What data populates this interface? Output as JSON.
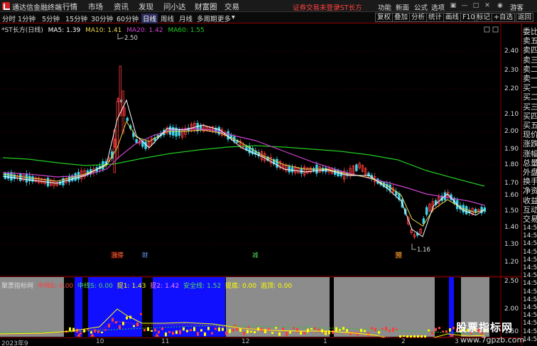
{
  "titlebar": {
    "app_title": "通达信金融终端",
    "menus": [
      "行情",
      "市场",
      "资讯",
      "发现",
      "问小达",
      "财富圈",
      "交易"
    ],
    "warning": "证券交易未登录",
    "stock_tab": "*ST长方",
    "right_menus": [
      "功能",
      "新面",
      "公式",
      "选项"
    ],
    "guest": "游客"
  },
  "toolbar": {
    "periods": [
      "分时",
      "1分钟",
      "5分钟",
      "15分钟",
      "30分钟",
      "60分钟",
      "日线",
      "周线",
      "月线",
      "多周期",
      "更多"
    ],
    "active_period": "日线",
    "right_buttons": [
      "复权",
      "叠加",
      "分析",
      "统计",
      "画线",
      "F10",
      "标记",
      "+自选",
      "返回"
    ]
  },
  "main_legend": {
    "stock": "*ST长方(日线)",
    "ma5": "MA5: 1.39",
    "ma10": "MA10: 1.41",
    "ma20": "MA20: 1.42",
    "ma60": "MA60: 1.55"
  },
  "annotations": {
    "high": "2.50",
    "low": "1.16",
    "tag1": "涨停",
    "tag2": "财",
    "tag3": "减",
    "tag4": "预"
  },
  "price_axis": [
    "2.40",
    "2.30",
    "2.20",
    "2.10",
    "2.00",
    "1.90",
    "1.80",
    "1.70",
    "1.60",
    "1.50",
    "1.40",
    "1.30",
    "1.20"
  ],
  "indicator": {
    "name": "聚票指标网",
    "fields": [
      {
        "label": "中线B:",
        "value": "0.00"
      },
      {
        "label": "中线S:",
        "value": "0.00"
      },
      {
        "label": "提1:",
        "value": "1.43"
      },
      {
        "label": "提2:",
        "value": "1.42"
      },
      {
        "label": "安全线:",
        "value": "1.52"
      },
      {
        "label": "提底:",
        "value": "0.00"
      },
      {
        "label": "逃顶:",
        "value": "0.00"
      }
    ],
    "axis": [
      "2.50",
      "2.00",
      "1.50"
    ]
  },
  "date_axis": [
    "2023年9",
    "10",
    "11",
    "12",
    "1",
    "2",
    "3"
  ],
  "side_panel": {
    "items": [
      "委比",
      "卖五",
      "卖四",
      "卖三",
      "卖二",
      "卖一",
      "买一",
      "买二",
      "买三",
      "买四",
      "买五",
      "现价",
      "涨跌",
      "涨幅",
      "总量",
      "外盘",
      "换手",
      "净资",
      "收益",
      "互动",
      "交易"
    ],
    "times": [
      "14:53",
      "14:53",
      "14:53",
      "14:53",
      "14:53",
      "14:53",
      "14:53",
      "14:53",
      "14:53",
      "14:53",
      "14:53",
      "14:53",
      "14:53",
      "14:53",
      "14:53"
    ]
  },
  "watermark": {
    "line1": "股票指标网",
    "line2": "www.7gpzb.com"
  },
  "colors": {
    "up": "#ff3b3b",
    "down": "#3fd2e8",
    "ma5": "#ffffff",
    "ma10": "#e8d44d",
    "ma20": "#cc44cc",
    "ma60": "#22cc22",
    "axis": "#8b0000",
    "indicator_blue": "#1010ff",
    "indicator_gray": "#8c8c8c"
  }
}
